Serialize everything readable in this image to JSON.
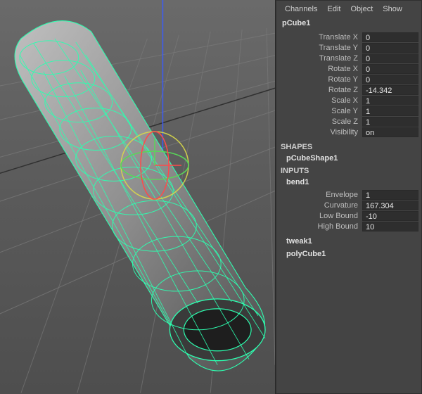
{
  "menu": {
    "channels": "Channels",
    "edit": "Edit",
    "object": "Object",
    "show": "Show"
  },
  "node": {
    "name": "pCube1"
  },
  "transform": {
    "translateX": {
      "label": "Translate X",
      "value": "0"
    },
    "translateY": {
      "label": "Translate Y",
      "value": "0"
    },
    "translateZ": {
      "label": "Translate Z",
      "value": "0"
    },
    "rotateX": {
      "label": "Rotate X",
      "value": "0"
    },
    "rotateY": {
      "label": "Rotate Y",
      "value": "0"
    },
    "rotateZ": {
      "label": "Rotate Z",
      "value": "-14.342"
    },
    "scaleX": {
      "label": "Scale X",
      "value": "1"
    },
    "scaleY": {
      "label": "Scale Y",
      "value": "1"
    },
    "scaleZ": {
      "label": "Scale Z",
      "value": "1"
    },
    "visibility": {
      "label": "Visibility",
      "value": "on"
    }
  },
  "shapes": {
    "heading": "SHAPES",
    "shapeName": "pCubeShape1"
  },
  "inputs": {
    "heading": "INPUTS",
    "bend": {
      "name": "bend1",
      "envelope": {
        "label": "Envelope",
        "value": "1"
      },
      "curvature": {
        "label": "Curvature",
        "value": "167.304"
      },
      "lowBound": {
        "label": "Low Bound",
        "value": "-10"
      },
      "highBound": {
        "label": "High Bound",
        "value": "10"
      }
    },
    "tweak": "tweak1",
    "polyCube": "polyCube1"
  },
  "viewport": {
    "gridColor": "#808080",
    "wireColor": "#40ffb0",
    "axisX": "#ff3a3a",
    "axisY": "#6eff3a",
    "axisZ": "#3a6eff"
  }
}
